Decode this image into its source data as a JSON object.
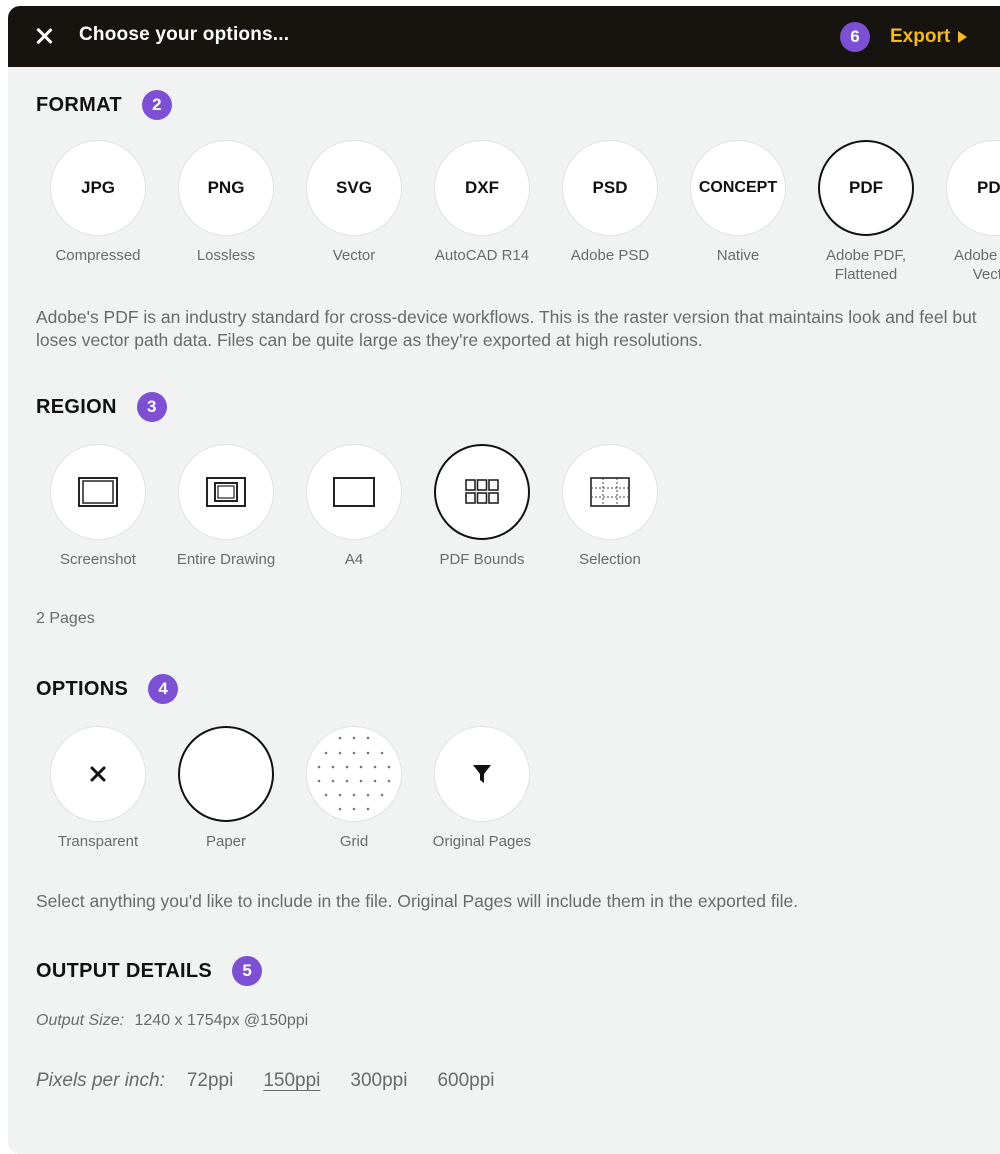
{
  "header": {
    "title": "Choose your options...",
    "export_badge": "6",
    "export_label": "Export",
    "accent_color": "#f5b921"
  },
  "format": {
    "title": "FORMAT",
    "badge": "2",
    "items": [
      {
        "code": "JPG",
        "label": "Compressed",
        "selected": false
      },
      {
        "code": "PNG",
        "label": "Lossless",
        "selected": false
      },
      {
        "code": "SVG",
        "label": "Vector",
        "selected": false
      },
      {
        "code": "DXF",
        "label": "AutoCAD R14",
        "selected": false
      },
      {
        "code": "PSD",
        "label": "Adobe PSD",
        "selected": false
      },
      {
        "code": "CONCEPT",
        "label": "Native",
        "selected": false
      },
      {
        "code": "PDF",
        "label": "Adobe PDF,\nFlattened",
        "selected": true
      },
      {
        "code": "PDF",
        "label": "Adobe PDF,\nVector",
        "selected": false
      }
    ],
    "description": "Adobe's PDF is an industry standard for cross-device workflows. This is the raster version that maintains look and feel but loses vector path data. Files can be quite large as they're exported at high resolutions."
  },
  "region": {
    "title": "REGION",
    "badge": "3",
    "items": [
      {
        "icon": "screenshot-icon",
        "label": "Screenshot",
        "selected": false
      },
      {
        "icon": "entire-drawing-icon",
        "label": "Entire Drawing",
        "selected": false
      },
      {
        "icon": "a4-icon",
        "label": "A4",
        "selected": false
      },
      {
        "icon": "pdf-bounds-icon",
        "label": "PDF Bounds",
        "selected": true
      },
      {
        "icon": "selection-icon",
        "label": "Selection",
        "selected": false
      }
    ],
    "pages": "2 Pages"
  },
  "options": {
    "title": "OPTIONS",
    "badge": "4",
    "items": [
      {
        "icon": "x-icon",
        "label": "Transparent",
        "selected": false
      },
      {
        "icon": "paper-icon",
        "label": "Paper",
        "selected": true
      },
      {
        "icon": "dot-grid-icon",
        "label": "Grid",
        "selected": false
      },
      {
        "icon": "funnel-icon",
        "label": "Original Pages",
        "selected": false
      }
    ],
    "description": "Select anything you'd like to include in the file. Original Pages will include them in the exported file."
  },
  "output": {
    "title": "OUTPUT DETAILS",
    "badge": "5",
    "size_label": "Output Size:",
    "size_value": "1240 x 1754px @150ppi",
    "ppi_label": "Pixels per inch:",
    "ppi_options": [
      "72ppi",
      "150ppi",
      "300ppi",
      "600ppi"
    ],
    "ppi_selected": "150ppi"
  },
  "badge_color": "#7c4fd3"
}
